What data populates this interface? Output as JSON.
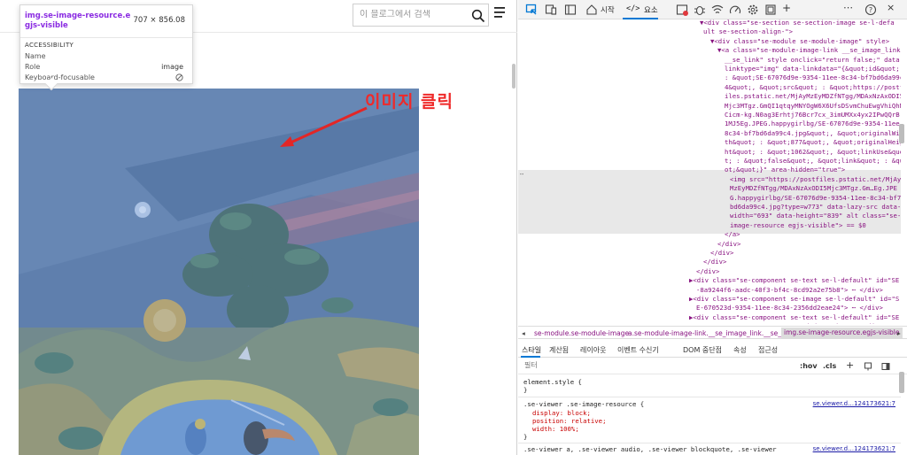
{
  "blog": {
    "search_placeholder": "이 블로그에서 검색"
  },
  "tooltip": {
    "element_name": "img.se-image-resource.egjs-visible",
    "size": "707 × 856.08",
    "section": "ACCESSIBILITY",
    "rows": [
      {
        "label": "Name",
        "value": ""
      },
      {
        "label": "Role",
        "value": "image"
      },
      {
        "label": "Keyboard-focusable",
        "value": ""
      }
    ]
  },
  "annotation": {
    "text": "이미지 클릭",
    "color": "#ef2a2a"
  },
  "devtools": {
    "tabs": [
      {
        "label": "시작"
      },
      {
        "label": "요소"
      }
    ],
    "dom_lines": [
      {
        "t": "▼<div class=\"se-section se-section-image se-l-defa"
      },
      {
        "t": "ult se-section-align-\">"
      },
      {
        "t": "▼<div class=\"se-module se-module-image\" style>"
      },
      {
        "t": "▼<a class=\"se-module-image-link __se_image_link"
      },
      {
        "t": "__se_link\" style onclick=\"return false;\" data-"
      },
      {
        "t": "linktype=\"img\" data-linkdata=\"{&quot;id&quot;"
      },
      {
        "t": ": &quot;SE-67076d9e-9354-11ee-8c34-bf7bd6da99c"
      },
      {
        "t": "4&quot;, &quot;src&quot; : &quot;https://postf"
      },
      {
        "t": "iles.pstatic.net/MjAyMzEyMDZfNTgg/MDAxNzAxODI5"
      },
      {
        "t": "Mjc3MTgz.GmQI1qtqyMNYOgW6X6UfsDSvmChuEwgVhiQhM"
      },
      {
        "t": "Cicm-kg.N0ag3Erhtj76Bcr7cx_3imUMXx4yx2IPwQQrB"
      },
      {
        "t": "1MJ5Eg.JPEG.happygirlbg/SE-67076d9e-9354-11ee-"
      },
      {
        "t": "8c34-bf7bd6da99c4.jpg&quot;, &quot;originalWid"
      },
      {
        "t": "th&quot; : &quot;877&quot;, &quot;originalHeig"
      },
      {
        "t": "ht&quot; : &quot;1062&quot;, &quot;linkUse&quo"
      },
      {
        "t": "t; : &quot;false&quot;, &quot;link&quot; : &qu"
      },
      {
        "t": "ot;&quot;}\" area-hidden=\"true\">"
      },
      {
        "t": "<img src=\"https://postfiles.pstatic.net/MjAy"
      },
      {
        "t": "MzEyMDZfNTgg/MDAxNzAxODI5Mjc3MTgz.Gm…Eg.JPE"
      },
      {
        "t": "G.happygirlbg/SE-67076d9e-9354-11ee-8c34-bf7"
      },
      {
        "t": "bd6da99c4.jpg?type=w773\" data-lazy-src data-"
      },
      {
        "t": "width=\"693\" data-height=\"839\" alt class=\"se-"
      },
      {
        "t": "image-resource egjs-visible\"> == $0"
      },
      {
        "t": "</a>"
      },
      {
        "t": "</div>"
      },
      {
        "t": "</div>"
      },
      {
        "t": "</div>"
      },
      {
        "t": "</div>"
      },
      {
        "t": "▶<div class=\"se-component se-text se-l-default\" id=\"SE"
      },
      {
        "t": "-8a9244f6-aadc-40f3-bf4c-8cd92a2e75b8\"> ⋯ </div>"
      },
      {
        "t": "▶<div class=\"se-component se-image se-l-default\" id=\"S"
      },
      {
        "t": "E-670523d-9354-11ee-8c34-2356dd2eae24\"> ⋯ </div>"
      },
      {
        "t": "▶<div class=\"se-component se-text se-l-default\" id=\"SE"
      },
      {
        "t": "-6e4e7006-5077-4160-a5c7-768d6d16463b\"> ⋯ </div>"
      }
    ],
    "breadcrumbs": [
      "se-module.se-module-image",
      "a.se-module-image-link.__se_image_link.__se_link",
      "img.se-image-resource.egjs-visible"
    ],
    "style_tabs": [
      "스타일",
      "계산됨",
      "레이아웃",
      "이벤트 수신기",
      "DOM 중단점",
      "속성",
      "접근성"
    ],
    "filter_placeholder": "필터",
    "filter_buttons": {
      "hov": ":hov",
      "cls": ".cls"
    },
    "rules": {
      "element_style": "element.style {",
      "close": "}",
      "rule1_selector": ".se-viewer .se-image-resource {",
      "rule1_source": "se.viewer.d…124173621:7",
      "rule1_props": [
        "display: block;",
        "position: relative;",
        "width: 100%;"
      ],
      "rule2_selector": ".se-viewer a, .se-viewer audio, .se-viewer blockquote, .se-viewer",
      "rule2_source": "se.viewer.d…124173621:7"
    }
  }
}
